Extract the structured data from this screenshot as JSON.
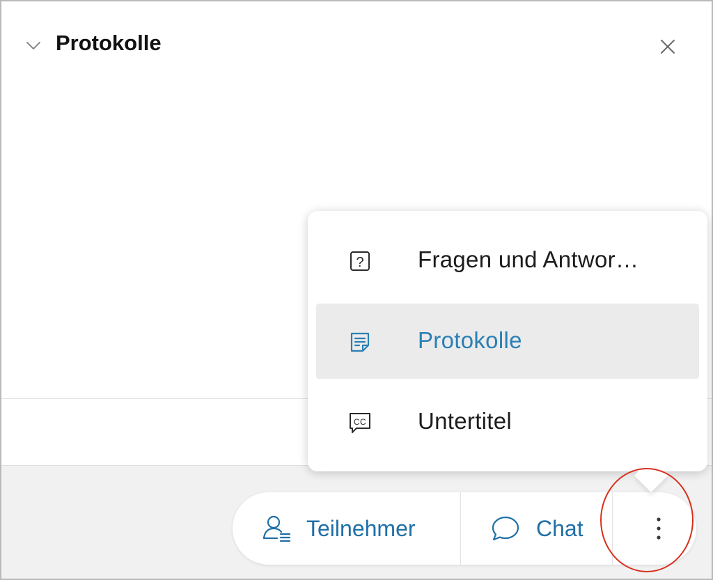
{
  "panel": {
    "title": "Protokolle",
    "collapse_icon": "chevron-down-icon",
    "close_icon": "close-icon"
  },
  "menu": {
    "items": [
      {
        "label": "Fragen und Antwor…",
        "icon": "question-icon",
        "selected": false
      },
      {
        "label": "Protokolle",
        "icon": "transcript-icon",
        "selected": true
      },
      {
        "label": "Untertitel",
        "icon": "closed-captions-icon",
        "selected": false
      }
    ]
  },
  "toolbar": {
    "participants_label": "Teilnehmer",
    "chat_label": "Chat",
    "more_icon": "more-vertical-icon"
  },
  "colors": {
    "accent": "#1f6fa6",
    "selected_text": "#2b7fb4",
    "highlight_ring": "#d8301d",
    "selected_row_bg": "#ebebeb"
  }
}
